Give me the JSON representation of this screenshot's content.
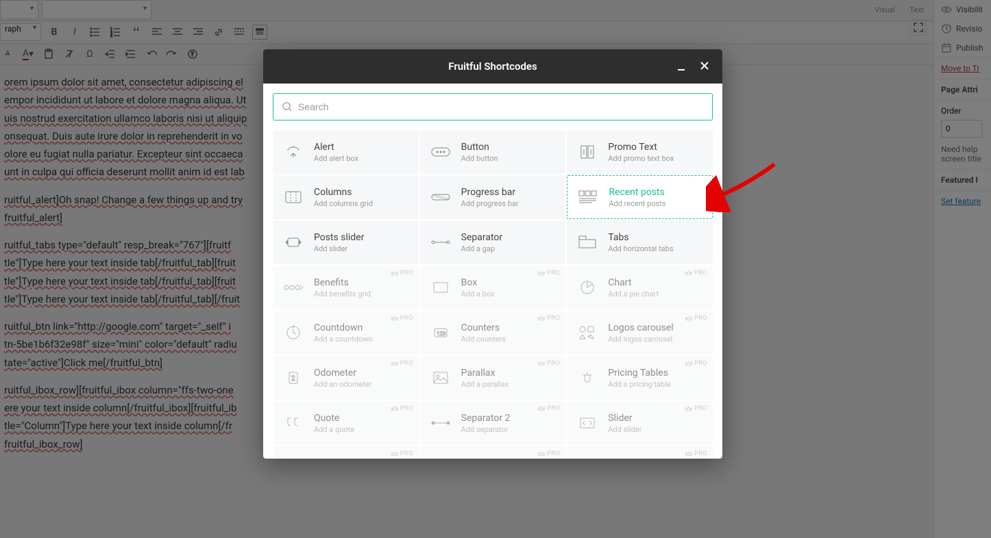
{
  "editor_tabs": {
    "visual": "Visual",
    "text": "Text"
  },
  "format_dropdown": "raph",
  "toolbar_icons": [
    "bold",
    "italic",
    "ul",
    "ol",
    "quote",
    "align-left",
    "align-center",
    "align-right",
    "link",
    "more",
    "toggle"
  ],
  "toolbar2_icons": [
    "underline",
    "text-color",
    "paste",
    "clear",
    "charmap",
    "outdent",
    "indent",
    "undo",
    "redo",
    "help"
  ],
  "editor_text": {
    "p1": "orem ipsum dolor sit amet, consectetur adipiscing el",
    "p2": "empor incididunt ut labore et dolore magna aliqua. Ut",
    "p3": "uis nostrud exercitation ullamco laboris nisi ut aliquip",
    "p4": "onsequat. Duis aute irure dolor in reprehenderit in vo",
    "p5": "olore eu fugiat nulla pariatur. Excepteur sint occaeca",
    "p6": "unt in culpa qui officia deserunt mollit anim id est lab",
    "p7": "ruitful_alert]Oh snap! Change a few things up and try",
    "p8": "fruitful_alert]",
    "p9": "ruitful_tabs type=\"default\" resp_break=\"767\"][fruitf",
    "p10": "tle\"]Type here your text inside tab[/fruitful_tab][fruit",
    "p11": "tle\"]Type here your text inside tab[/fruitful_tab][fruit",
    "p12": "tle\"]Type here your text inside tab[/fruitful_tab][/fruit",
    "p13": "ruitful_btn link=\"http://google.com\" target=\"_self\" i",
    "p14": "tn-5be1b6f32e98f\" size=\"mini\" color=\"default\" radiu",
    "p15": "tate=\"active\"]Click me[/fruitful_btn]",
    "p16": "ruitful_ibox_row][fruitful_ibox column=\"ffs-two-one",
    "p17": "ere your text inside column[/fruitful_ibox][fruitful_ib",
    "p18": "tle=\"Column\"]Type here your text inside column[/fr",
    "p19": "fruitful_ibox_row]"
  },
  "sidebar": {
    "visibility": "Visibilit",
    "revisions": "Revisio",
    "publish": "Publish",
    "move_trash": "Move to Tr",
    "page_attr": "Page Attri",
    "order_label": "Order",
    "order_value": "0",
    "need_help": "Need help",
    "screen_title": "screen title",
    "featured": "Featured I",
    "set_featured": "Set feature"
  },
  "modal": {
    "title": "Fruitful Shortcodes",
    "search_placeholder": "Search",
    "pro_label": "PRO",
    "items": [
      {
        "title": "Alert",
        "sub": "Add alert box"
      },
      {
        "title": "Button",
        "sub": "Add button"
      },
      {
        "title": "Promo Text",
        "sub": "Add promo text box"
      },
      {
        "title": "Columns",
        "sub": "Add columns grid"
      },
      {
        "title": "Progress bar",
        "sub": "Add progress bar"
      },
      {
        "title": "Recent posts",
        "sub": "Add recent posts"
      },
      {
        "title": "Posts slider",
        "sub": "Add slider"
      },
      {
        "title": "Separator",
        "sub": "Add a gap"
      },
      {
        "title": "Tabs",
        "sub": "Add horizontal tabs"
      },
      {
        "title": "Benefits",
        "sub": "Add benefits grid"
      },
      {
        "title": "Box",
        "sub": "Add a box"
      },
      {
        "title": "Chart",
        "sub": "Add a pie chart"
      },
      {
        "title": "Countdown",
        "sub": "Add a countdown"
      },
      {
        "title": "Counters",
        "sub": "Add counters"
      },
      {
        "title": "Logos carousel",
        "sub": "Add logos carousel"
      },
      {
        "title": "Odometer",
        "sub": "Add an odometer"
      },
      {
        "title": "Parallax",
        "sub": "Add a parallax"
      },
      {
        "title": "Pricing Tables",
        "sub": "Add a pricing table"
      },
      {
        "title": "Quote",
        "sub": "Add a quote"
      },
      {
        "title": "Separator 2",
        "sub": "Add separator"
      },
      {
        "title": "Slider",
        "sub": "Add slider"
      }
    ]
  }
}
